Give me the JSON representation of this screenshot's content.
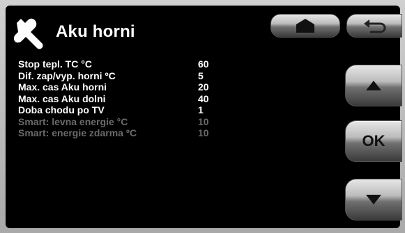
{
  "header": {
    "title": "Aku horni",
    "icon": "wrench-icon"
  },
  "params": [
    {
      "name": "Stop tepl. TC °C",
      "value": "60",
      "enabled": true
    },
    {
      "name": "Dif. zap/vyp. horni ºC",
      "value": "5",
      "enabled": true
    },
    {
      "name": "Max. cas Aku horni",
      "value": "20",
      "enabled": true
    },
    {
      "name": "Max. cas Aku dolni",
      "value": "40",
      "enabled": true
    },
    {
      "name": "Doba chodu po TV",
      "value": "1",
      "enabled": true
    },
    {
      "name": "Smart: levna energie °C",
      "value": "10",
      "enabled": false
    },
    {
      "name": "Smart: energie zdarma ºC",
      "value": "10",
      "enabled": false
    }
  ],
  "buttons": {
    "home_icon": "home-icon",
    "back_icon": "back-arrow-icon",
    "up_icon": "arrow-up-icon",
    "ok_label": "OK",
    "down_icon": "arrow-down-icon"
  },
  "colors": {
    "screen_bg": "#000000",
    "text_active": "#ffffff",
    "text_disabled": "#6a6a6a"
  }
}
